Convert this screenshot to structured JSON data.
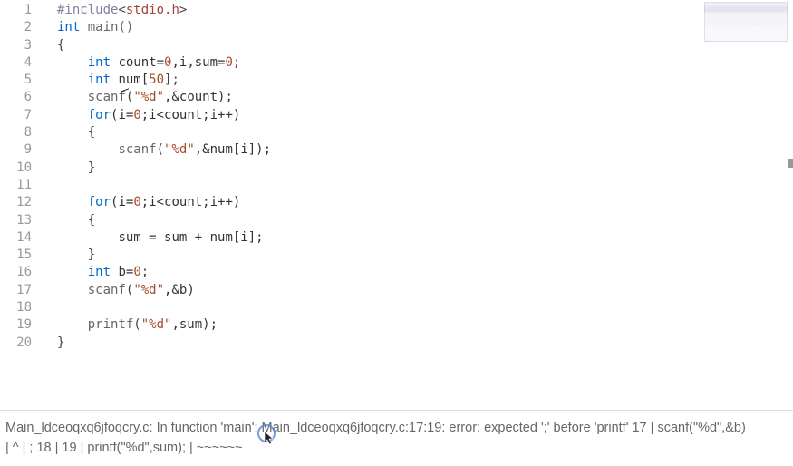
{
  "lines": {
    "count": 20
  },
  "code": {
    "l1_include": "#include",
    "l1_lt": "<",
    "l1_hdr": "stdio.h",
    "l1_gt": ">",
    "l2_int": "int",
    "l2_main": " main()",
    "l3": "{",
    "l4_int": "int",
    "l4_rest": " count=",
    "l4_zero": "0",
    "l4_rest2": ",i,sum=",
    "l4_zero2": "0",
    "l4_semi": ";",
    "l5_int": "int",
    "l5_rest": " num[",
    "l5_50": "50",
    "l5_rest2": "];",
    "l6_scanf": "scanf",
    "l6_open": "(",
    "l6_fmt": "\"%d\"",
    "l6_rest": ",&count);",
    "l7_for": "for",
    "l7_rest": "(i=",
    "l7_zero": "0",
    "l7_rest2": ";i<count;i++)",
    "l8": "{",
    "l9_scanf": "scanf",
    "l9_open": "(",
    "l9_fmt": "\"%d\"",
    "l9_rest": ",&num[i]);",
    "l10": "}",
    "l11": "",
    "l12_for": "for",
    "l12_rest": "(i=",
    "l12_zero": "0",
    "l12_rest2": ";i<count;i++)",
    "l13": "{",
    "l14": "sum = sum + num[i];",
    "l15": "}",
    "l16_int": "int",
    "l16_rest": " b=",
    "l16_zero": "0",
    "l16_semi": ";",
    "l17_scanf": "scanf",
    "l17_open": "(",
    "l17_fmt": "\"%d\"",
    "l17_rest": ",&b)",
    "l18": "",
    "l19_printf": "printf",
    "l19_open": "(",
    "l19_fmt": "\"%d\"",
    "l19_rest": ",sum);",
    "l20": "}"
  },
  "console": {
    "line1": "Main_ldceoqxq6jfoqcry.c: In function 'main': Main_ldceoqxq6jfoqcry.c:17:19: error: expected ';' before 'printf' 17 | scanf(\"%d\",&b)",
    "line2": "| ^ | ; 18 | 19 | printf(\"%d\",sum); | ~~~~~~"
  }
}
